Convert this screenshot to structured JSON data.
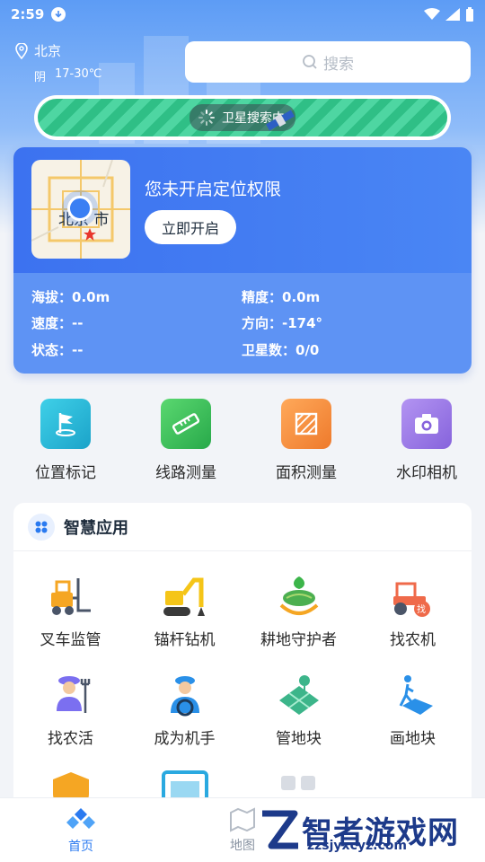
{
  "status_bar": {
    "time": "2:59"
  },
  "location": {
    "city": "北京",
    "weather": "阴",
    "temperature": "17-30℃"
  },
  "search": {
    "placeholder": "搜索"
  },
  "satellite": {
    "status": "卫星搜索中"
  },
  "location_card": {
    "map_label": "北京 市",
    "permission_title": "您未开启定位权限",
    "enable_button": "立即开启",
    "stats": [
      {
        "label": "海拔：",
        "value": "0.0m"
      },
      {
        "label": "精度：",
        "value": "0.0m"
      },
      {
        "label": "速度：",
        "value": "--"
      },
      {
        "label": "方向：",
        "value": "-174°"
      },
      {
        "label": "状态：",
        "value": "--"
      },
      {
        "label": "卫星数：",
        "value": "0/0"
      }
    ]
  },
  "tools": [
    {
      "label": "位置标记",
      "icon": "flag-pin-icon",
      "color": "#22b8d8"
    },
    {
      "label": "线路测量",
      "icon": "ruler-icon",
      "color": "#3cc25a"
    },
    {
      "label": "面积测量",
      "icon": "area-icon",
      "color": "#f08a3a"
    },
    {
      "label": "水印相机",
      "icon": "camera-icon",
      "color": "#9a78e8"
    }
  ],
  "smart_apps": {
    "title": "智慧应用",
    "items": [
      {
        "label": "叉车监管",
        "icon": "forklift-icon"
      },
      {
        "label": "锚杆钻机",
        "icon": "drill-rig-icon"
      },
      {
        "label": "耕地守护者",
        "icon": "farmland-guard-icon"
      },
      {
        "label": "找农机",
        "icon": "tractor-icon"
      },
      {
        "label": "找农活",
        "icon": "farmer-icon"
      },
      {
        "label": "成为机手",
        "icon": "driver-icon"
      },
      {
        "label": "管地块",
        "icon": "field-manage-icon"
      },
      {
        "label": "画地块",
        "icon": "field-draw-icon"
      }
    ]
  },
  "bottom_nav": [
    {
      "label": "首页",
      "active": true
    },
    {
      "label": "地图",
      "active": false
    }
  ],
  "watermark": {
    "name": "智者游戏网",
    "url": "zzsjyxcyz.com"
  }
}
